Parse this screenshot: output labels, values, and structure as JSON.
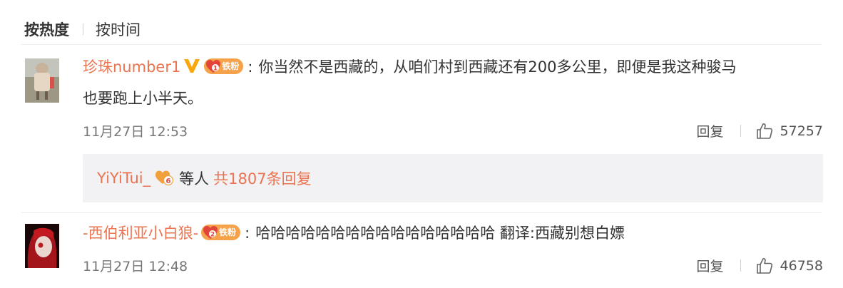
{
  "sort_tabs": {
    "hot_label": "按热度",
    "time_label": "按时间"
  },
  "comments": [
    {
      "username": "珍珠number1",
      "badge_label": "铁粉",
      "badge_level": "1",
      "text_line1": "你当然不是西藏的，从咱们村到西藏还有200多公里，即便是我这种骏马",
      "text_line2": "也要跑上小半天。",
      "timestamp": "11月27日 12:53",
      "reply_label": "回复",
      "likes": "57257"
    },
    {
      "username": "-西伯利亚小白狼-",
      "badge_label": "铁粉",
      "badge_level": "2",
      "text_line1": "哈哈哈哈哈哈哈哈哈哈哈哈哈哈哈哈 翻译:西藏别想白嫖",
      "timestamp": "11月27日 12:48",
      "reply_label": "回复",
      "likes": "46758"
    }
  ],
  "sub_replies": {
    "username": "YiYiTui_",
    "badge_level": "6",
    "etc_label": "等人",
    "more_label": "共1807条回复"
  },
  "colors": {
    "username": "#eb7350",
    "badge": "#f5a24a",
    "verified": "#f8a80d"
  }
}
